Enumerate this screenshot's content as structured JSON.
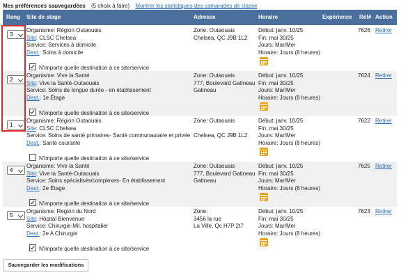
{
  "top": {
    "title": "Mes préférences sauvegardées",
    "count": "(5 choix à faire)",
    "stats_link": "Montrer les statistiques des camarades de classe"
  },
  "columns": {
    "rank": "Rang",
    "site": "Site de stage",
    "address": "Adresse",
    "schedule": "Horaire",
    "experience": "Expérience",
    "ref": "Réf#",
    "action": "Action"
  },
  "rows": [
    {
      "rank": "3",
      "organisme": "Organisme: Région Outaouais",
      "site_label": "Site",
      "site_value": ": CLSC Chelsea",
      "service": "Service: Services à domicile",
      "dest_label": "Dest.",
      "dest_value": ": Soins à domicile",
      "check_label": "N'importe quelle destination à ce site/service",
      "checked": true,
      "addr1": "Zone: Outaouais",
      "addr2": "",
      "addr3": "Chelsea, QC J9B 1L2",
      "debut": "Début: janv. 10/25",
      "fin": "Fin: mai 30/25",
      "jours": "Jours: Mar/Mer",
      "horaire": "Horaire: Jours (8 heures)",
      "ref": "7626",
      "action": "Retirer"
    },
    {
      "rank": "2",
      "organisme": "Organisme: Vive la Santé",
      "site_label": "Site",
      "site_value": ": Vive la Santé-Outaouais",
      "service": "Service: Soins de longue durée - en établissement",
      "dest_label": "Dest.",
      "dest_value": ": 1e Étage",
      "check_label": "N'importe quelle destination à ce site/service",
      "checked": true,
      "addr1": "Zone: Outaouais",
      "addr2": "777, Boulevard Gatineau",
      "addr3": "Gatineau",
      "debut": "Début: janv. 10/25",
      "fin": "Fin: mai 30/25",
      "jours": "Jours: Mar/Mer",
      "horaire": "Horaire: Jours (8 heures)",
      "ref": "7624",
      "action": "Retirer"
    },
    {
      "rank": "1",
      "organisme": "Organisme: Région Outaouais",
      "site_label": "Site",
      "site_value": ": CLSC Chelsea",
      "service": "Service: Soins de santé primaires- Santé communautaire et privée",
      "dest_label": "Dest.",
      "dest_value": ": Santé courante",
      "check_label": "N'importe quelle destination à ce site/service",
      "checked": false,
      "addr1": "Zone: Outaouais",
      "addr2": "Chelsea, QC J9B 1L2",
      "addr3": "",
      "debut": "Début: janv. 10/25",
      "fin": "Fin: mai 30/25",
      "jours": "Jours: Mar/Mer",
      "horaire": "Horaire: Jours (8 heures)",
      "ref": "7622",
      "action": "Retirer"
    },
    {
      "rank": "4",
      "organisme": "Organisme: Vive la Santé",
      "site_label": "Site",
      "site_value": ": Vive la Santé-Outaouais",
      "service": "Service: Soins spécialisés/complexes- En établissement",
      "dest_label": "Dest.",
      "dest_value": ": 2e Étage",
      "check_label": "N'importe quelle destination à ce site/service",
      "checked": true,
      "addr1": "Zone: Outaouais",
      "addr2": "777, Boulevard Gatineau",
      "addr3": "Gatineau",
      "debut": "Début: janv. 10/25",
      "fin": "Fin: mai 30/25",
      "jours": "Jours: Mar/Mer",
      "horaire": "Horaire: Jours (8 heures)",
      "ref": "7625",
      "action": "Retirer"
    },
    {
      "rank": "5",
      "organisme": "Organisme: Region du Nord",
      "site_label": "Site",
      "site_value": ": Hôpital Bienvenue",
      "service": "Service: Chirurgie-Mil. hospitalier",
      "dest_label": "Dest.",
      "dest_value": ": 2e A Chirurgie",
      "check_label": "N'importe quelle destination à ce site/service",
      "checked": true,
      "addr1": "Zone:",
      "addr2": "3456 la rue",
      "addr3": "La Ville, Qc H7P 2t7",
      "debut": "Début: janv. 10/25",
      "fin": "Fin: mai 30/25",
      "jours": "Jours: Mar/Mer",
      "horaire": "Horaire: Jours (8 heures)",
      "ref": "7623",
      "action": "Retirer"
    }
  ],
  "save_button": "Sauvegarder les modifications",
  "colors": {
    "header_bg": "#4a6f9c",
    "link": "#2a6db5",
    "highlight": "#d62b2b",
    "calendar": "#e8a419"
  }
}
